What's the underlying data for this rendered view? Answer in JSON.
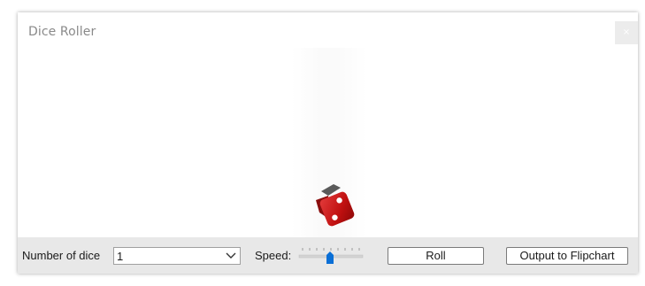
{
  "dialog": {
    "title": "Dice Roller",
    "close_label": "×"
  },
  "die": {
    "face_value": 2,
    "color": "#c81010"
  },
  "toolbar": {
    "dice_count_label": "Number of dice",
    "dice_count_value": "1",
    "speed_label": "Speed:",
    "speed_level": 0.5,
    "roll_label": "Roll",
    "output_label": "Output to Flipchart"
  },
  "colors": {
    "toolbar_bg": "#e8e8e8",
    "slider_thumb": "#0a6fd6"
  }
}
